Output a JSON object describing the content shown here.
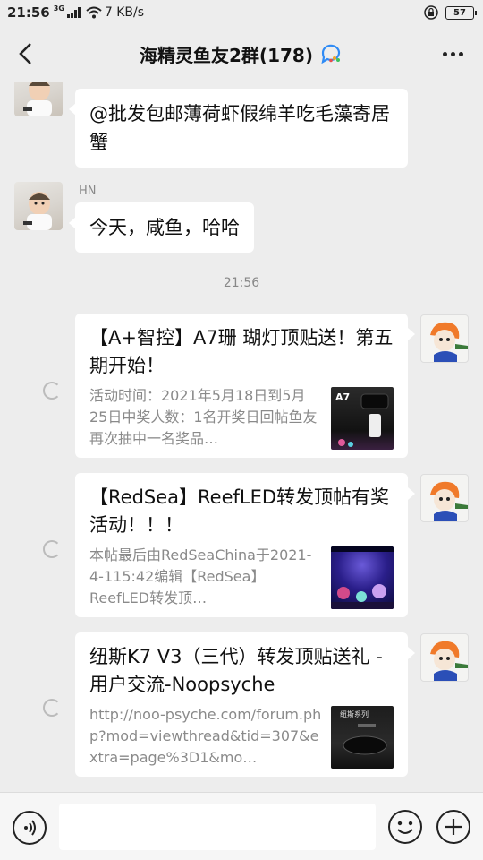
{
  "status_bar": {
    "time": "21:56",
    "network": "3G",
    "speed": "7 KB/s",
    "battery": "57"
  },
  "header": {
    "title": "海精灵鱼友2群(178)",
    "back_icon": "chevron-left-icon",
    "more_icon": "more-dots-icon",
    "group_icon": "group-chat-icon"
  },
  "messages": [
    {
      "type": "text",
      "sender": "",
      "text": "@批发包邮薄荷虾假绵羊吃毛藻寄居蟹"
    },
    {
      "type": "text",
      "sender": "HN",
      "text": "今天，咸鱼，哈哈"
    }
  ],
  "timestamp": "21:56",
  "cards": [
    {
      "title": "【A+智控】A7珊 瑚灯顶贴送！第五期开始！",
      "desc": "活动时间：2021年5月18日到5月25日中奖人数：1名开奖日回帖鱼友再次抽中一名奖品…",
      "thumb_label": "A7"
    },
    {
      "title": "【RedSea】ReefLED转发顶帖有奖活动！！！",
      "desc": "本帖最后由RedSeaChina于2021-4-115:42编辑【RedSea】ReefLED转发顶…",
      "thumb_label": ""
    },
    {
      "title": "纽斯K7 V3（三代）转发顶贴送礼 - 用户交流-Noopsyche",
      "desc": "http://noo-psyche.com/forum.php?mod=viewthread&tid=307&extra=page%3D1&mo…",
      "thumb_label": "纽斯系列"
    }
  ],
  "input_bar": {
    "placeholder": "",
    "voice_icon": "voice-icon",
    "emoji_icon": "emoji-icon",
    "plus_icon": "plus-icon"
  },
  "colors": {
    "background": "#ededed",
    "bubble": "#ffffff",
    "muted_text": "#888888"
  }
}
